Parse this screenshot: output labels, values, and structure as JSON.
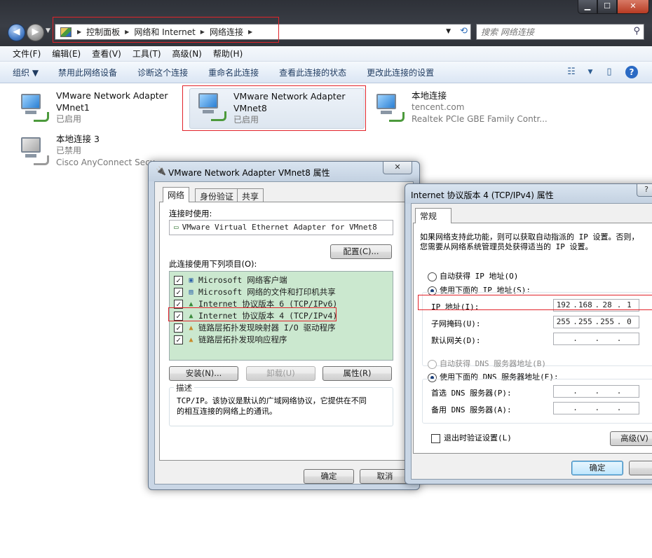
{
  "breadcrumbs": [
    "控制面板",
    "网络和 Internet",
    "网络连接"
  ],
  "search_placeholder": "搜索 网络连接",
  "menu": [
    "文件(F)",
    "编辑(E)",
    "查看(V)",
    "工具(T)",
    "高级(N)",
    "帮助(H)"
  ],
  "toolbar": {
    "organize": "组织 ▼",
    "items": [
      "禁用此网络设备",
      "诊断这个连接",
      "重命名此连接",
      "查看此连接的状态",
      "更改此连接的设置"
    ]
  },
  "caption_buttons": [
    "▁",
    "☐",
    "✕"
  ],
  "adapters": [
    {
      "name": "VMware Network Adapter",
      "line2": "VMnet1",
      "line3": "已启用"
    },
    {
      "name": "VMware Network Adapter",
      "line2": "VMnet8",
      "line3": "已启用"
    },
    {
      "name": "本地连接",
      "line2": "tencent.com",
      "line3": "Realtek PCIe GBE Family Contr..."
    },
    {
      "name": "本地连接 3",
      "line2": "已禁用",
      "line3": "Cisco AnyConnect Secu"
    }
  ],
  "props_dialog": {
    "title": "VMware Network Adapter VMnet8 属性",
    "tabs": [
      "网络",
      "身份验证",
      "共享"
    ],
    "connect_using_label": "连接时使用:",
    "adapter_field": "VMware Virtual Ethernet Adapter for VMnet8",
    "configure_button": "配置(C)...",
    "items_label": "此连接使用下列项目(O):",
    "items": [
      {
        "icon": "client",
        "label": "Microsoft 网络客户端"
      },
      {
        "icon": "share",
        "label": "Microsoft 网络的文件和打印机共享"
      },
      {
        "icon": "protocol",
        "label": "Internet 协议版本 6 (TCP/IPv6)"
      },
      {
        "icon": "protocol",
        "label": "Internet 协议版本 4 (TCP/IPv4)"
      },
      {
        "icon": "protocol",
        "label": "链路层拓扑发现映射器 I/O 驱动程序"
      },
      {
        "icon": "protocol",
        "label": "链路层拓扑发现响应程序"
      }
    ],
    "install_button": "安装(N)...",
    "uninstall_button": "卸载(U)",
    "properties_button": "属性(R)",
    "description_title": "描述",
    "description_text_1": "TCP/IP。该协议是默认的广域网络协议，它提供在不同",
    "description_text_2": "的相互连接的网络上的通讯。",
    "ok_button": "确定",
    "cancel_button": "取消"
  },
  "ipv4_dialog": {
    "title": "Internet 协议版本 4 (TCP/IPv4) 属性",
    "tab": "常规",
    "intro_1": "如果网络支持此功能，则可以获取自动指派的 IP 设置。否则，",
    "intro_2": "您需要从网络系统管理员处获得适当的 IP 设置。",
    "auto_ip": "自动获得 IP 地址(O)",
    "manual_ip": "使用下面的 IP 地址(S):",
    "ip_label": "IP 地址(I):",
    "ip": [
      "192",
      "168",
      "28",
      "1"
    ],
    "mask_label": "子网掩码(U):",
    "mask": [
      "255",
      "255",
      "255",
      "0"
    ],
    "gateway_label": "默认网关(D):",
    "auto_dns": "自动获得 DNS 服务器地址(B)",
    "manual_dns": "使用下面的 DNS 服务器地址(E):",
    "dns1_label": "首选 DNS 服务器(P):",
    "dns2_label": "备用 DNS 服务器(A):",
    "validate_label": "退出时验证设置(L)",
    "advanced_button": "高级(V)",
    "ok_button": "确定"
  }
}
